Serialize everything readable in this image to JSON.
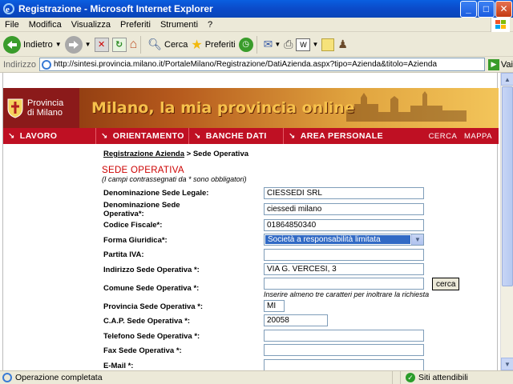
{
  "window": {
    "title": "Registrazione - Microsoft Internet Explorer",
    "minimize": "_",
    "maximize": "□",
    "close": "✕"
  },
  "menu": [
    "File",
    "Modifica",
    "Visualizza",
    "Preferiti",
    "Strumenti",
    "?"
  ],
  "toolbar": {
    "back_label": "Indietro",
    "search_label": "Cerca",
    "favorites_label": "Preferiti"
  },
  "address": {
    "label": "Indirizzo",
    "url": "http://sintesi.provincia.milano.it/PortaleMilano/Registrazione/DatiAzienda.aspx?tipo=Azienda&titolo=Azienda",
    "go_label": "Vai"
  },
  "banner": {
    "org_line1": "Provincia",
    "org_line2": "di Milano",
    "slogan": "Milano, la mia provincia online"
  },
  "nav": {
    "items": [
      "LAVORO",
      "ORIENTAMENTO",
      "BANCHE DATI",
      "AREA PERSONALE"
    ],
    "search": "CERCA",
    "map": "MAPPA"
  },
  "breadcrumb": {
    "link": "Registrazione Azienda",
    "separator": " > ",
    "current": "Sede Operativa"
  },
  "form": {
    "title": "SEDE OPERATIVA",
    "note": "(I campi contrassegnati da * sono obbligatori)",
    "fields": {
      "denominazione_legale": {
        "label": "Denominazione Sede Legale:",
        "value": "CIESSEDI SRL"
      },
      "denominazione_operativa": {
        "label": "Denominazione Sede Operativa*:",
        "value": "ciessedi milano"
      },
      "codice_fiscale": {
        "label": "Codice Fiscale*:",
        "value": "01864850340"
      },
      "forma_giuridica": {
        "label": "Forma Giuridica*:",
        "value": "Società a responsabilità limitata"
      },
      "partita_iva": {
        "label": "Partita IVA:",
        "value": ""
      },
      "indirizzo": {
        "label": "Indirizzo Sede Operativa *:",
        "value": "VIA G. VERCESI, 3"
      },
      "comune": {
        "label": "Comune Sede Operativa *:",
        "value": "",
        "button": "cerca",
        "hint": "Inserire almeno tre caratteri per inoltrare la richiesta"
      },
      "provincia": {
        "label": "Provincia Sede Operativa *:",
        "value": "MI"
      },
      "cap": {
        "label": "C.A.P. Sede Operativa *:",
        "value": "20058"
      },
      "telefono": {
        "label": "Telefono Sede Operativa *:",
        "value": ""
      },
      "fax": {
        "label": "Fax Sede Operativa *:",
        "value": ""
      },
      "email": {
        "label": "E-Mail *:",
        "value": ""
      }
    }
  },
  "status": {
    "left": "Operazione completata",
    "zone": "Siti attendibili"
  },
  "colors": {
    "nav_red": "#bf1023",
    "section_red": "#cc0000",
    "xp_blue": "#0a5fe0"
  }
}
